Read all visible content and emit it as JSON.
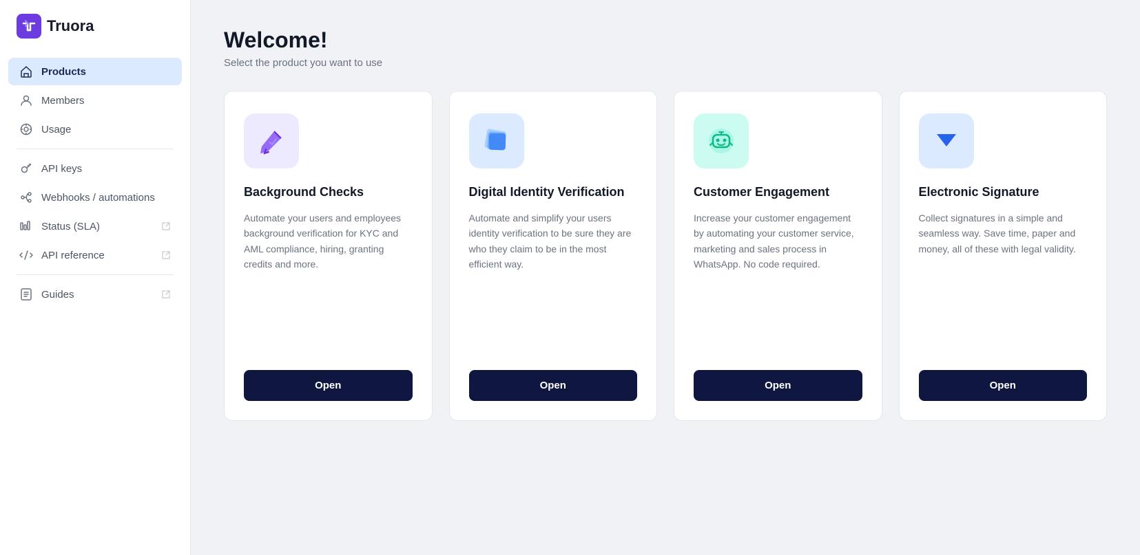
{
  "logo": {
    "text": "Truora"
  },
  "sidebar": {
    "items": [
      {
        "id": "products",
        "label": "Products",
        "icon": "home-icon",
        "active": true,
        "external": false
      },
      {
        "id": "members",
        "label": "Members",
        "icon": "members-icon",
        "active": false,
        "external": false
      },
      {
        "id": "usage",
        "label": "Usage",
        "icon": "usage-icon",
        "active": false,
        "external": false
      },
      {
        "id": "api-keys",
        "label": "API keys",
        "icon": "api-keys-icon",
        "active": false,
        "external": false
      },
      {
        "id": "webhooks",
        "label": "Webhooks / automations",
        "icon": "webhooks-icon",
        "active": false,
        "external": false
      },
      {
        "id": "status",
        "label": "Status (SLA)",
        "icon": "status-icon",
        "active": false,
        "external": true
      },
      {
        "id": "api-reference",
        "label": "API reference",
        "icon": "api-reference-icon",
        "active": false,
        "external": true
      },
      {
        "id": "guides",
        "label": "Guides",
        "icon": "guides-icon",
        "active": false,
        "external": true
      }
    ]
  },
  "page": {
    "title": "Welcome!",
    "subtitle": "Select the product you want to use"
  },
  "products": [
    {
      "id": "background-checks",
      "title": "Background Checks",
      "description": "Automate your users and employees background verification for KYC and AML compliance, hiring, granting credits and more.",
      "icon_color": "purple",
      "button_label": "Open"
    },
    {
      "id": "digital-identity",
      "title": "Digital Identity Verification",
      "description": "Automate and simplify your users identity verification to be sure they are who they claim to be in the most efficient way.",
      "icon_color": "blue",
      "button_label": "Open"
    },
    {
      "id": "customer-engagement",
      "title": "Customer Engagement",
      "description": "Increase your customer engagement by automating your customer service, marketing and sales process in WhatsApp. No code required.",
      "icon_color": "teal",
      "button_label": "Open"
    },
    {
      "id": "electronic-signature",
      "title": "Electronic Signature",
      "description": "Collect signatures in a simple and seamless way. Save time, paper and money, all of these with legal validity.",
      "icon_color": "light-blue",
      "button_label": "Open"
    }
  ]
}
